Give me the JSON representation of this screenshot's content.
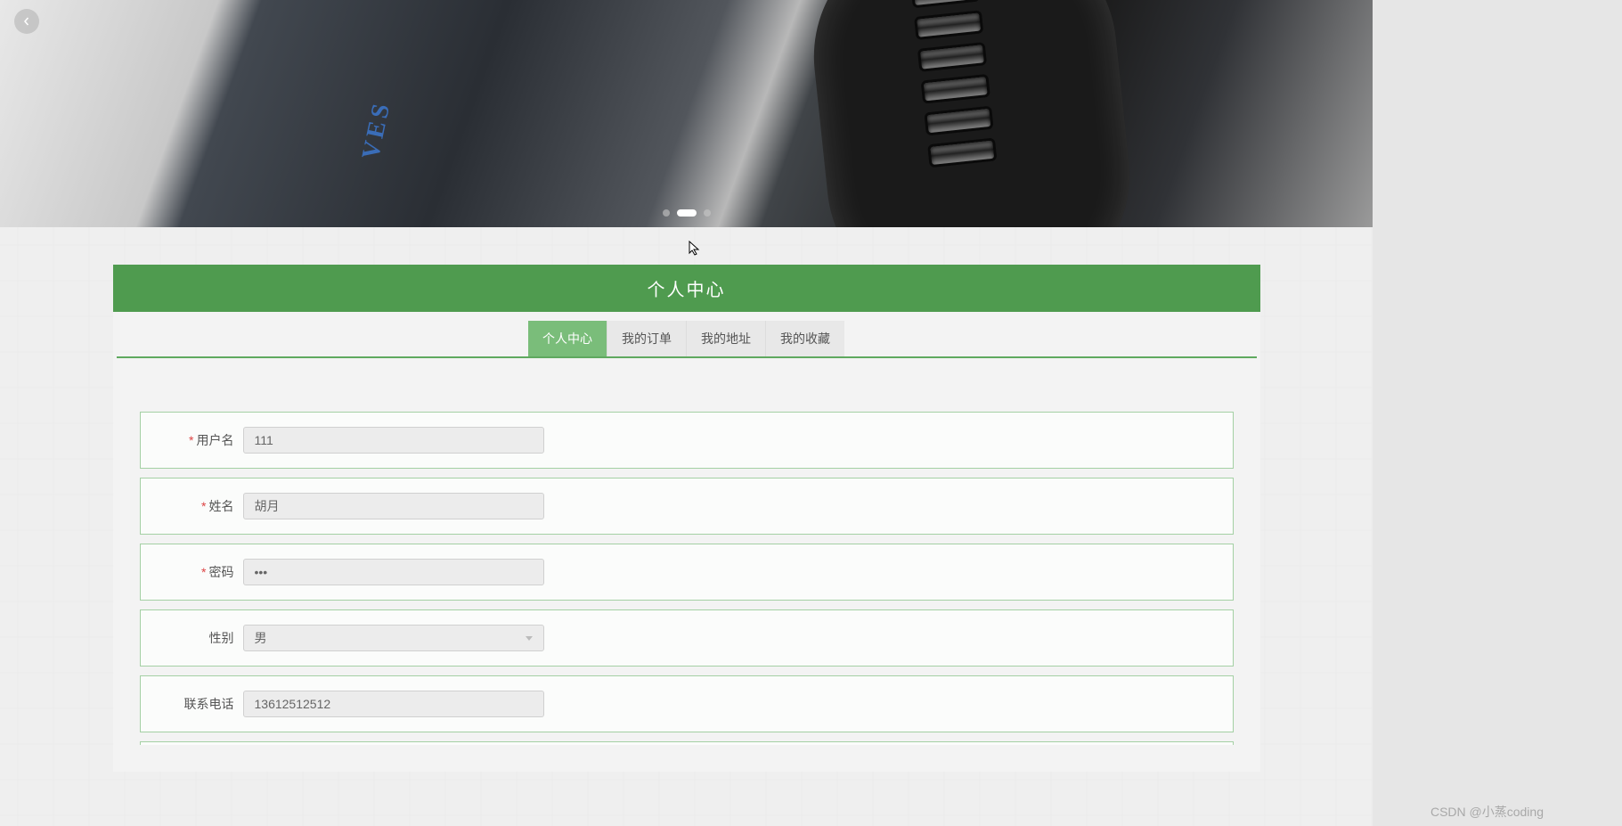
{
  "section_title": "个人中心",
  "tabs": [
    {
      "label": "个人中心",
      "active": true
    },
    {
      "label": "我的订单",
      "active": false
    },
    {
      "label": "我的地址",
      "active": false
    },
    {
      "label": "我的收藏",
      "active": false
    }
  ],
  "form": {
    "username": {
      "label": "用户名",
      "value": "111",
      "required": true
    },
    "name": {
      "label": "姓名",
      "value": "胡月",
      "required": true
    },
    "password": {
      "label": "密码",
      "value": "•••",
      "required": true
    },
    "gender": {
      "label": "性别",
      "value": "男",
      "required": false
    },
    "phone": {
      "label": "联系电话",
      "value": "13612512512",
      "required": false
    }
  },
  "carousel": {
    "active_index": 1,
    "total": 3
  },
  "hero_logo_text": "VES",
  "watermark": "CSDN @小蒸coding",
  "required_mark": "*"
}
